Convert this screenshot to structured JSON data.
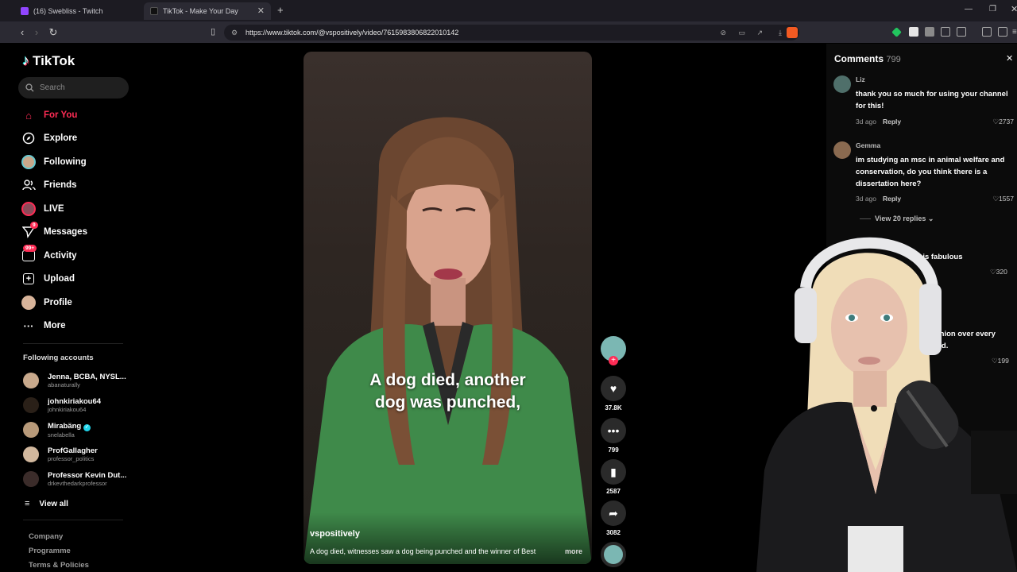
{
  "browser": {
    "tabs": [
      {
        "title": "(16) Swebliss - Twitch",
        "active": false
      },
      {
        "title": "TikTok - Make Your Day",
        "active": true
      }
    ],
    "new_tab": "+",
    "url": "https://www.tiktok.com/@vspositively/video/7615983806822010142"
  },
  "sidebar": {
    "logo": "TikTok",
    "search_placeholder": "Search",
    "nav": [
      {
        "label": "For You",
        "icon": "home-icon",
        "active": true
      },
      {
        "label": "Explore",
        "icon": "compass-icon"
      },
      {
        "label": "Following",
        "icon": "following-avatar-icon"
      },
      {
        "label": "Friends",
        "icon": "friends-icon"
      },
      {
        "label": "LIVE",
        "icon": "live-avatar-icon"
      },
      {
        "label": "Messages",
        "icon": "send-icon",
        "badge": "9"
      },
      {
        "label": "Activity",
        "icon": "activity-icon",
        "badge": "99+"
      },
      {
        "label": "Upload",
        "icon": "upload-icon"
      },
      {
        "label": "Profile",
        "icon": "profile-avatar-icon"
      },
      {
        "label": "More",
        "icon": "more-icon"
      }
    ],
    "following_title": "Following accounts",
    "accounts": [
      {
        "name": "Jenna, BCBA, NYSL...",
        "handle": "abanaturally",
        "verified": false
      },
      {
        "name": "johnkiriakou64",
        "handle": "johnkiriakou64",
        "verified": false
      },
      {
        "name": "Mirabäng",
        "handle": "snelabella",
        "verified": true
      },
      {
        "name": "ProfGallagher",
        "handle": "professor_politics",
        "verified": false
      },
      {
        "name": "Professor Kevin Dut...",
        "handle": "drkevthedarkprofessor",
        "verified": false
      }
    ],
    "view_all": "View all",
    "footer": [
      "Company",
      "Programme",
      "Terms & Policies"
    ]
  },
  "video": {
    "caption_line1": "A dog died, another",
    "caption_line2": "dog was punched,",
    "author": "vspositively",
    "description": "A dog died, witnesses saw a dog being punched and the winner of Best",
    "more": "more",
    "actions": {
      "likes": "37.8K",
      "comments": "799",
      "saves": "2587",
      "shares": "3082"
    }
  },
  "comments": {
    "title": "Comments",
    "count": "799",
    "items": [
      {
        "user": "Liz",
        "text": "thank you so much for using your channel for this!",
        "time": "3d ago",
        "reply": "Reply",
        "likes": "2737"
      },
      {
        "user": "Gemma",
        "text": "im studying an msc in animal welfare and conservation, do you think there is a dissertation here?",
        "time": "3d ago",
        "reply": "Reply",
        "likes": "1557"
      }
    ],
    "view_replies": "View 20 replies",
    "partial1_text": "r is fabulous",
    "partial1_likes": "320",
    "partial2_text_a": "inion over every",
    "partial2_text_b": "eld.",
    "partial2_likes": "199"
  },
  "colors": {
    "accent": "#fe2c55",
    "bg": "#000000",
    "chrome": "#2b2a33"
  }
}
